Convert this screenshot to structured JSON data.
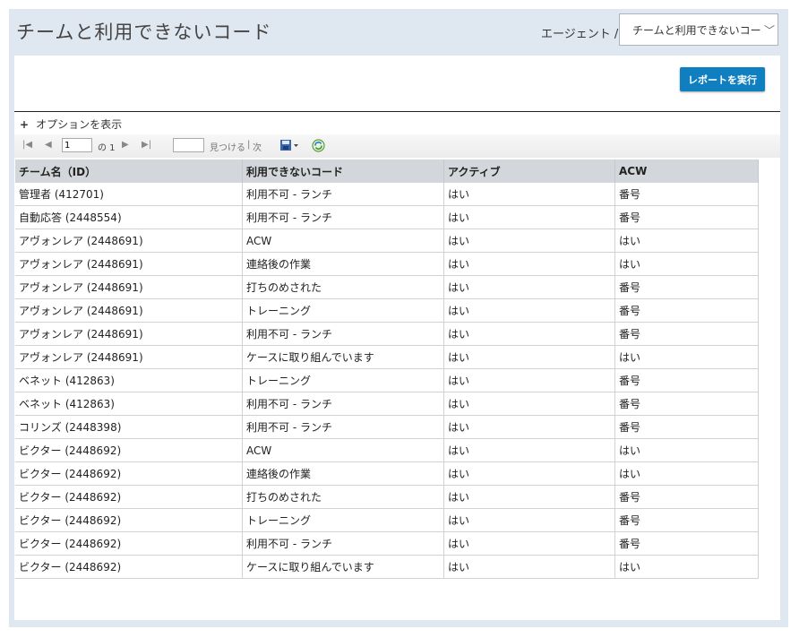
{
  "header": {
    "title": "チームと利用できないコード",
    "agent_label": "エージェント /",
    "report_select_value": "チームと利用できないコード"
  },
  "toolbar": {
    "run_report_label": "レポートを実行",
    "options_label": "オプションを表示",
    "page_value": "1",
    "of_label": "の 1",
    "find_label": "見つける",
    "next_label": "次"
  },
  "table": {
    "headers": [
      "チーム名（ID）",
      "利用できないコード",
      "アクティブ",
      "ACW"
    ],
    "rows": [
      [
        "管理者 (412701)",
        "利用不可 - ランチ",
        "はい",
        "番号"
      ],
      [
        "自動応答 (2448554)",
        "利用不可 - ランチ",
        "はい",
        "番号"
      ],
      [
        "アヴォンレア (2448691)",
        "ACW",
        "はい",
        "はい"
      ],
      [
        "アヴォンレア (2448691)",
        "連絡後の作業",
        "はい",
        "はい"
      ],
      [
        "アヴォンレア (2448691)",
        "打ちのめされた",
        "はい",
        "番号"
      ],
      [
        "アヴォンレア (2448691)",
        "トレーニング",
        "はい",
        "番号"
      ],
      [
        "アヴォンレア (2448691)",
        "利用不可 - ランチ",
        "はい",
        "番号"
      ],
      [
        "アヴォンレア (2448691)",
        "ケースに取り組んでいます",
        "はい",
        "はい"
      ],
      [
        "ベネット (412863)",
        "トレーニング",
        "はい",
        "番号"
      ],
      [
        "ベネット (412863)",
        "利用不可 - ランチ",
        "はい",
        "番号"
      ],
      [
        "コリンズ (2448398)",
        "利用不可 - ランチ",
        "はい",
        "番号"
      ],
      [
        "ビクター (2448692)",
        "ACW",
        "はい",
        "はい"
      ],
      [
        "ビクター (2448692)",
        "連絡後の作業",
        "はい",
        "はい"
      ],
      [
        "ビクター (2448692)",
        "打ちのめされた",
        "はい",
        "番号"
      ],
      [
        "ビクター (2448692)",
        "トレーニング",
        "はい",
        "番号"
      ],
      [
        "ビクター (2448692)",
        "利用不可 - ランチ",
        "はい",
        "番号"
      ],
      [
        "ビクター (2448692)",
        "ケースに取り組んでいます",
        "はい",
        "はい"
      ]
    ]
  },
  "colors": {
    "frame_bg": "#dfe7f0",
    "run_button_bg": "#0f7fbf",
    "header_row_bg": "#d3d7db"
  },
  "icons": [
    "first-page-icon",
    "prev-page-icon",
    "next-page-icon",
    "last-page-icon",
    "export-icon",
    "refresh-icon",
    "chevron-down-icon",
    "plus-icon"
  ]
}
